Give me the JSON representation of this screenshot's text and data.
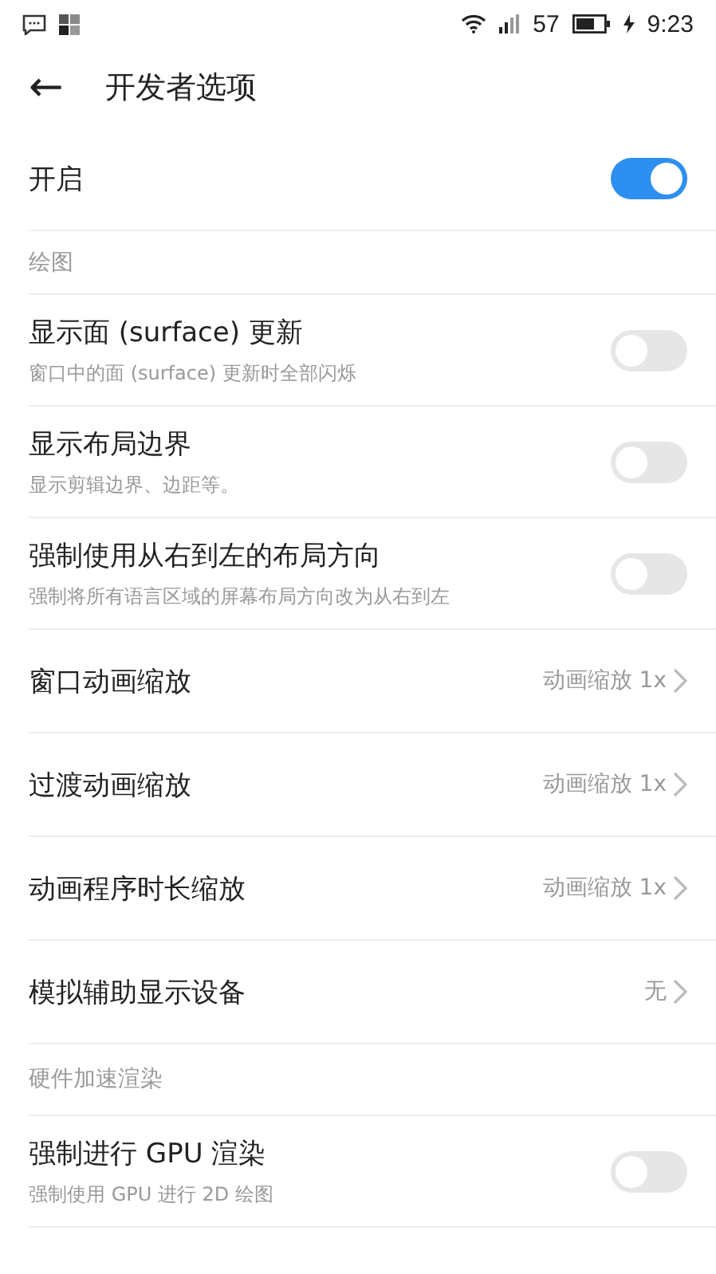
{
  "status_bar": {
    "battery": "57",
    "time": "9:23"
  },
  "header": {
    "back": "←",
    "title": "开发者选项"
  },
  "items": [
    {
      "kind": "toggle",
      "title": "开启",
      "on": true
    },
    {
      "kind": "section",
      "title": "绘图"
    },
    {
      "kind": "toggle",
      "title": "显示面 (surface) 更新",
      "subtitle": "窗口中的面 (surface) 更新时全部闪烁",
      "on": false
    },
    {
      "kind": "toggle",
      "title": "显示布局边界",
      "subtitle": "显示剪辑边界、边距等。",
      "on": false
    },
    {
      "kind": "toggle",
      "title": "强制使用从右到左的布局方向",
      "subtitle": "强制将所有语言区域的屏幕布局方向改为从右到左",
      "on": false
    },
    {
      "kind": "nav",
      "title": "窗口动画缩放",
      "value": "动画缩放 1x"
    },
    {
      "kind": "nav",
      "title": "过渡动画缩放",
      "value": "动画缩放 1x"
    },
    {
      "kind": "nav",
      "title": "动画程序时长缩放",
      "value": "动画缩放 1x"
    },
    {
      "kind": "nav",
      "title": "模拟辅助显示设备",
      "value": "无"
    },
    {
      "kind": "section",
      "title": "硬件加速渲染"
    },
    {
      "kind": "toggle",
      "title": "强制进行 GPU 渲染",
      "subtitle": "强制使用 GPU 进行 2D 绘图",
      "on": false
    }
  ]
}
